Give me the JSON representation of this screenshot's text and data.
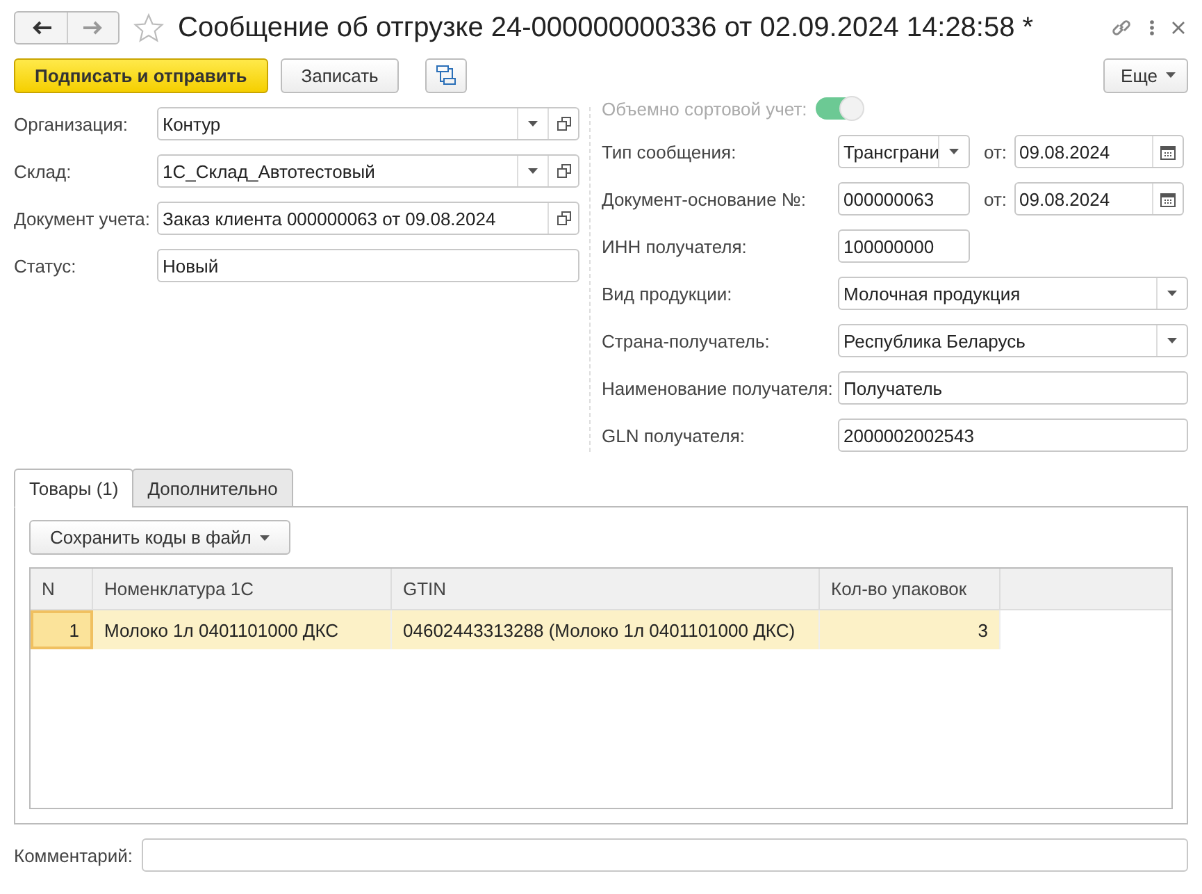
{
  "window": {
    "title": "Сообщение об отгрузке 24-000000000336 от 02.09.2024 14:28:58 *",
    "starred": false
  },
  "toolbar": {
    "buttons": [
      {
        "label": "Подписать и отправить",
        "kind": "primary"
      },
      {
        "label": "Записать",
        "kind": "plain"
      },
      {
        "kind": "icon"
      }
    ],
    "more": "Еще"
  },
  "left_fields": [
    {
      "label": "Организация:",
      "value": "Контур",
      "kind": "select_open"
    },
    {
      "label": "Склад:",
      "value": "1С_Склад_Автотестовый",
      "kind": "select_open"
    },
    {
      "label": "Документ учета:",
      "value": "Заказ клиента 000000063 от 09.08.2024",
      "kind": "open"
    },
    {
      "label": "Статус:",
      "value": "Новый",
      "kind": "text"
    }
  ],
  "toggle": {
    "label": "Объемно сортовой учет:",
    "on": true,
    "disabled": true
  },
  "right_fields": [
    {
      "label": "Тип сообщения:",
      "value": "Трансграни",
      "kind": "select_date",
      "date_label": "от:",
      "date": "09.08.2024"
    },
    {
      "label": "Документ-основание №:",
      "value": "000000063",
      "kind": "text_date",
      "date_label": "от:",
      "date": "09.08.2024"
    },
    {
      "label": "ИНН получателя:",
      "value": "100000000",
      "kind": "short"
    },
    {
      "label": "Вид продукции:",
      "value": "Молочная продукция",
      "kind": "select"
    },
    {
      "label": "Страна-получатель:",
      "value": "Республика Беларусь",
      "kind": "select"
    },
    {
      "label": "Наименование получателя:",
      "value": "Получатель",
      "kind": "text"
    },
    {
      "label": "GLN получателя:",
      "value": "2000002002543",
      "kind": "text"
    }
  ],
  "tabs": [
    {
      "label": "Товары (1)",
      "selected": true
    },
    {
      "label": "Дополнительно",
      "selected": false
    }
  ],
  "tab_toolbar": {
    "button": "Сохранить коды в файл"
  },
  "table": {
    "columns": [
      "N",
      "Номенклатура 1С",
      "GTIN",
      "Кол-во упаковок"
    ],
    "rows": [
      {
        "cells": [
          "1",
          "Молоко 1л 0401101000 ДКС",
          "04602443313288 (Молоко 1л 0401101000 ДКС)",
          "3"
        ],
        "selected": true
      }
    ]
  },
  "comment": {
    "label": "Комментарий:"
  }
}
